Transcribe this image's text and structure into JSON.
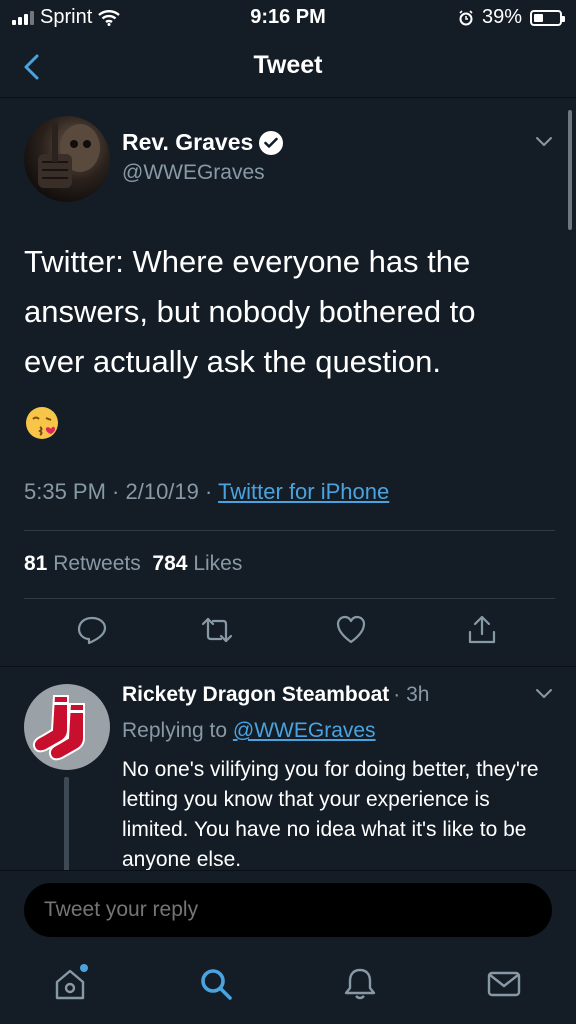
{
  "status": {
    "carrier": "Sprint",
    "time": "9:16 PM",
    "battery_pct": "39%",
    "battery_level": 0.39
  },
  "nav": {
    "title": "Tweet"
  },
  "tweet": {
    "author_name": "Rev. Graves",
    "author_handle": "@WWEGraves",
    "text": "Twitter: Where everyone has the answers, but nobody bothered to ever actually ask the question.",
    "emoji": "kiss-emoji",
    "time": "5:35 PM · 2/10/19 · ",
    "source": "Twitter for iPhone",
    "retweets": "81",
    "retweets_label": "Retweets",
    "likes": "784",
    "likes_label": "Likes"
  },
  "reply": {
    "author_name": "Rickety Dragon Steamboat",
    "time": "· 3h",
    "replying_prefix": "Replying to ",
    "replying_to": "@WWEGraves",
    "text": "No one's vilifying you for doing better, they're letting you know that your experience is limited. You have no idea what it's like to be anyone else."
  },
  "composer": {
    "placeholder": "Tweet your reply"
  },
  "colors": {
    "accent": "#4aa3df",
    "background": "#141d26",
    "muted": "#8899a6"
  }
}
